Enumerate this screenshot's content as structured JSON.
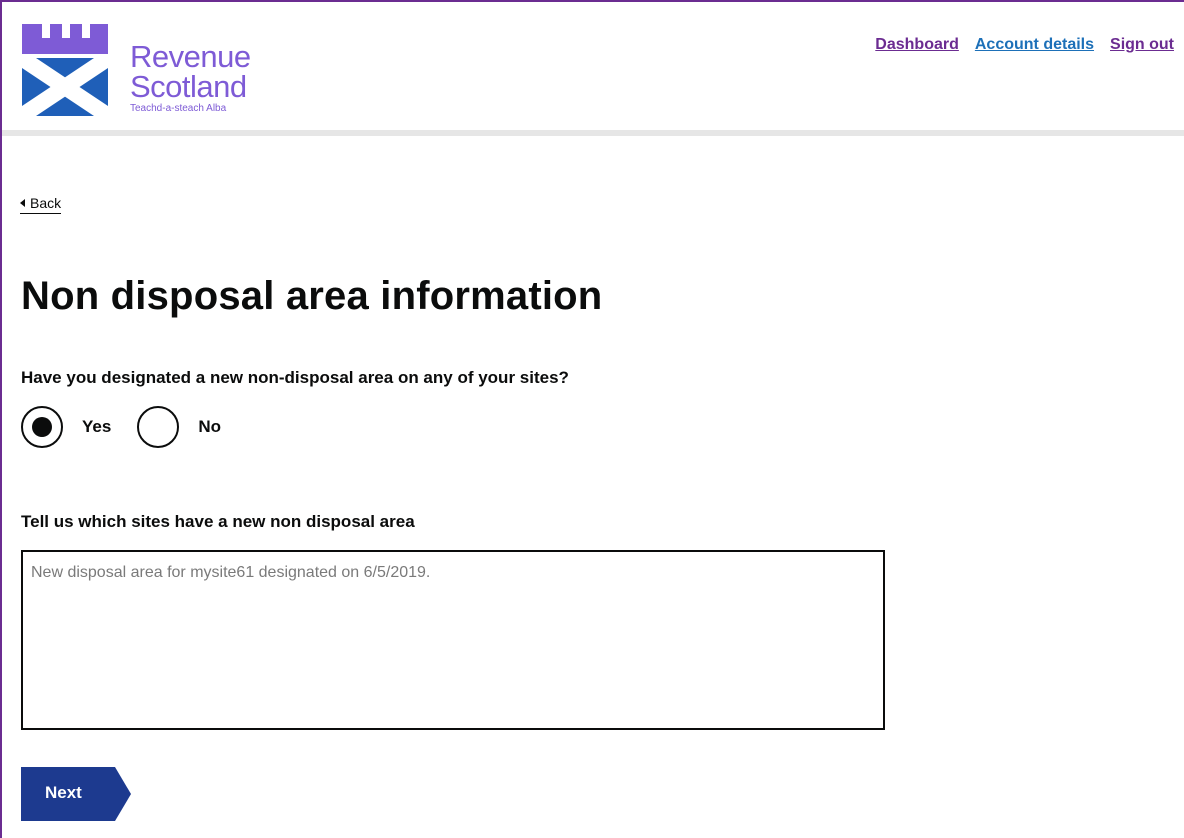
{
  "header": {
    "logo": {
      "line1": "Revenue",
      "line2": "Scotland",
      "line3": "Teachd-a-steach Alba"
    },
    "nav": {
      "dashboard": "Dashboard",
      "account_details": "Account details",
      "sign_out": "Sign out"
    }
  },
  "back_link": "Back",
  "page_title": "Non disposal area information",
  "question": {
    "text": "Have you designated a new non-disposal area on any of your sites?",
    "options": [
      "Yes",
      "No"
    ],
    "selected": "Yes"
  },
  "sites_field": {
    "label": "Tell us which sites have a new non disposal area",
    "placeholder": "New disposal area for mysite61 designated on 6/5/2019."
  },
  "next_button": "Next",
  "colors": {
    "brand_purple": "#7e5bd6",
    "brand_blue": "#1f5fb8",
    "button_navy": "#1d3a8f",
    "link_purple": "#6b2c91",
    "link_blue": "#1d70b8"
  }
}
